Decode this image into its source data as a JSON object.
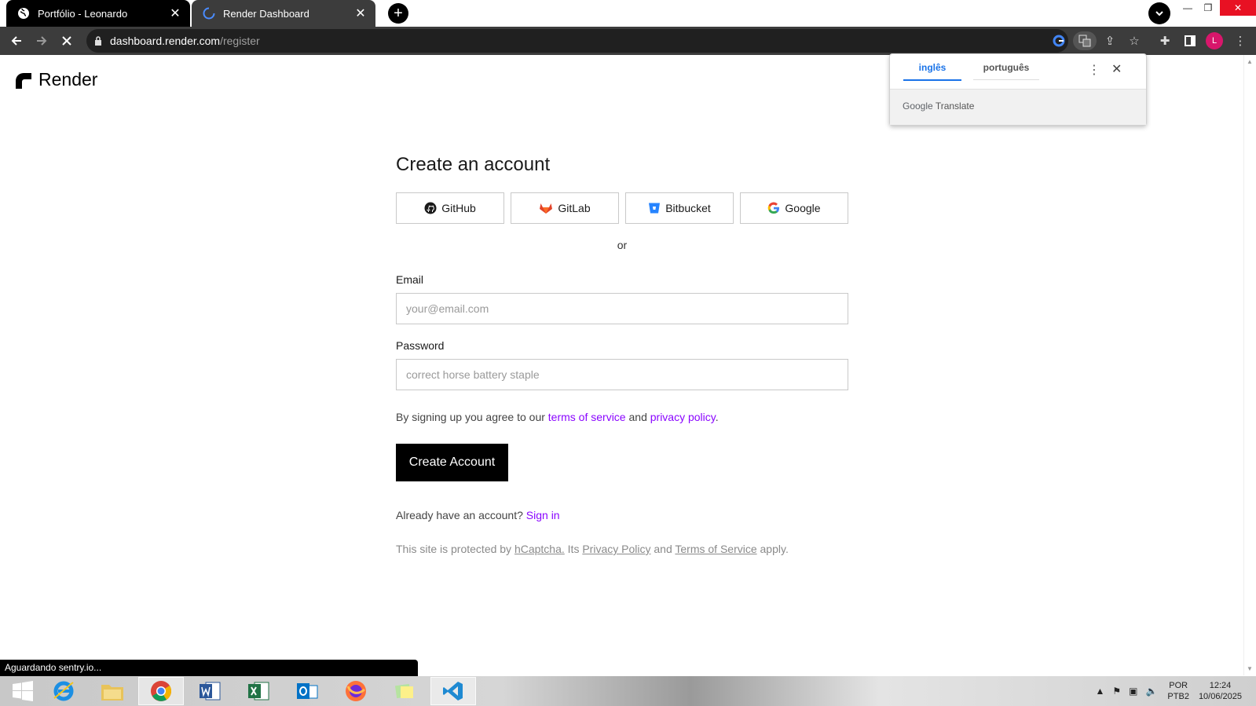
{
  "browser": {
    "tabs": [
      {
        "title": "Portfólio - Leonardo",
        "active": true
      },
      {
        "title": "Render Dashboard",
        "active": false
      }
    ],
    "url_host": "dashboard.render.com",
    "url_path": "/register",
    "profile_initial": "L"
  },
  "logo": {
    "text": "Render"
  },
  "signup": {
    "title": "Create an account",
    "oauth": {
      "github": "GitHub",
      "gitlab": "GitLab",
      "bitbucket": "Bitbucket",
      "google": "Google"
    },
    "or_text": "or",
    "email_label": "Email",
    "email_placeholder": "your@email.com",
    "password_label": "Password",
    "password_placeholder": "correct horse battery staple",
    "terms_prefix": "By signing up you agree to our",
    "terms_link": "terms of service",
    "terms_and": "and",
    "privacy_link": "privacy policy",
    "terms_suffix": ".",
    "submit_label": "Create Account",
    "signin_prefix": "Already have an account?",
    "signin_link": "Sign in",
    "captcha_prefix": "This site is protected by",
    "captcha_link": "hCaptcha.",
    "captcha_its": "Its",
    "captcha_privacy": "Privacy Policy",
    "captcha_and": "and",
    "captcha_terms": "Terms of Service",
    "captcha_suffix": "apply."
  },
  "translate_popup": {
    "lang_source": "inglês",
    "lang_target": "português",
    "footer_brand": "Google",
    "footer_product": "Translate"
  },
  "status_bar": {
    "text": "Aguardando sentry.io..."
  },
  "taskbar": {
    "lang_line1": "POR",
    "lang_line2": "PTB2",
    "time": "12:24",
    "date": "10/06/2025"
  },
  "colors": {
    "accent_link": "#8a05ff",
    "button_bg": "#000000",
    "translate_active": "#1a73e8"
  }
}
